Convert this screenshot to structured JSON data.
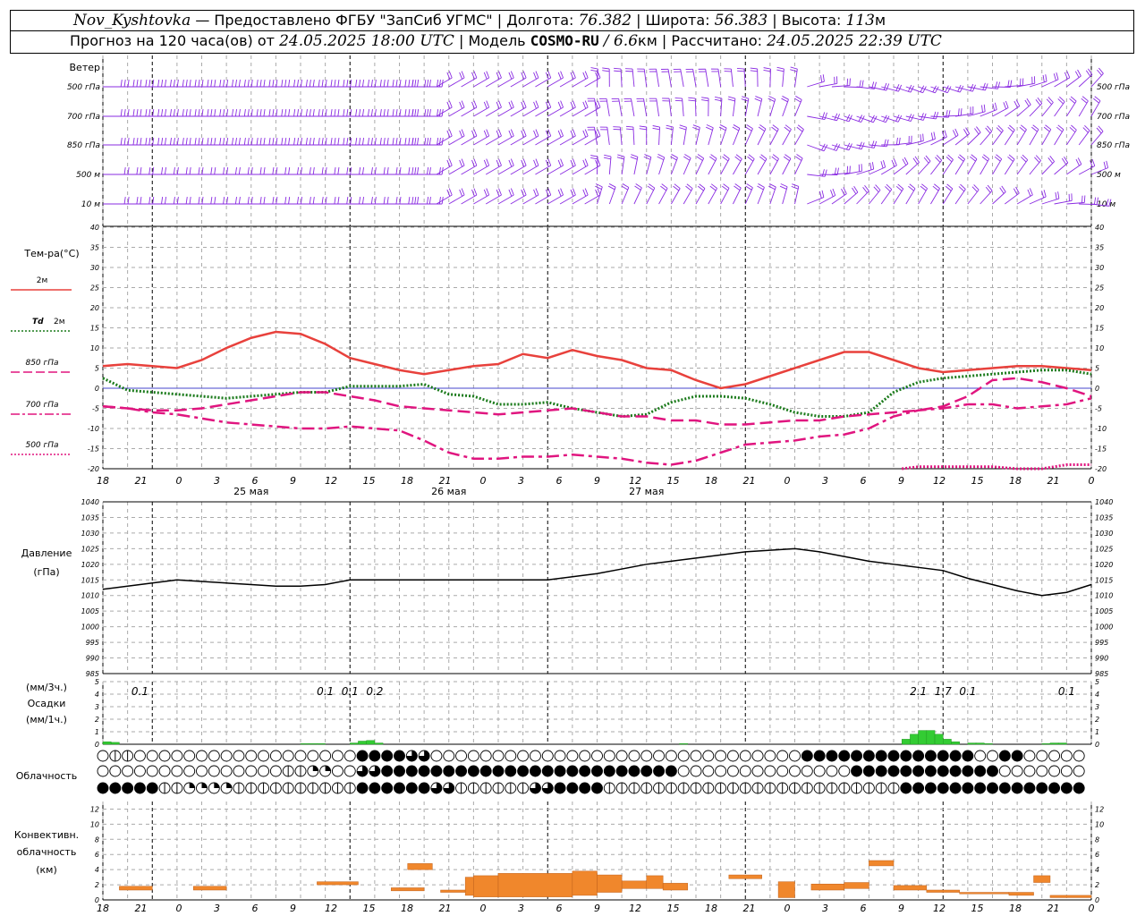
{
  "header": {
    "station": "Nov_Kyshtovka",
    "provider": "— Предоставлено ФГБУ \"ЗапСиб УГМС\" |",
    "lon_label": "Долгота:",
    "lon_value": "76.382",
    "lat_label": "| Широта:",
    "lat_value": "56.383",
    "alt_label": "| Высота:",
    "alt_value": "113",
    "alt_unit": "м",
    "forecast_label": "Прогноз на 120 часа(ов) от",
    "forecast_time": "24.05.2025 18:00 UTC",
    "model_label": "| Модель",
    "model_name": "COSMO-RU",
    "model_res": "/ 6.6",
    "model_res_unit": "км |",
    "calc_label": "Рассчитано:",
    "calc_time": "24.05.2025 22:39 UTC"
  },
  "time_axis": {
    "hour_labels": [
      "18",
      "21",
      "0",
      "3",
      "6",
      "9",
      "12",
      "15",
      "18",
      "21",
      "0",
      "3",
      "6",
      "9",
      "12",
      "15",
      "18",
      "21",
      "0",
      "3",
      "6",
      "9",
      "12",
      "15",
      "18",
      "21",
      "0"
    ],
    "day_labels": [
      "25 мая",
      "26 мая",
      "27 мая"
    ]
  },
  "wind_panel": {
    "title": "Ветер",
    "levels": [
      "500 гПа",
      "700 гПа",
      "850 гПа",
      "500 м",
      "10 м"
    ],
    "color": "#8a2be2"
  },
  "colors": {
    "t2m": "#e8413c",
    "td2m": "#1a7a1a",
    "t850": "#e0157f",
    "t700": "#e0157f",
    "t500": "#e0157f",
    "pressure": "#000000",
    "precip": "#33cc33",
    "convective": "#f0872c",
    "zero_line": "#4444cc"
  },
  "temp_panel": {
    "title": "Тем-ра(°C)",
    "legend": [
      {
        "label": "2м",
        "key": "t2m"
      },
      {
        "label": "Td",
        "label2": "2м",
        "key": "td2m"
      },
      {
        "label": "850 гПа",
        "key": "t850"
      },
      {
        "label": "700 гПа",
        "key": "t700"
      },
      {
        "label": "500 гПа",
        "key": "t500"
      }
    ],
    "y_ticks": [
      "40",
      "35",
      "30",
      "25",
      "20",
      "15",
      "10",
      "5",
      "0",
      "-5",
      "-10",
      "-15",
      "-20"
    ]
  },
  "pressure_panel": {
    "title": "Давление",
    "unit": "(гПа)",
    "y_ticks": [
      "1040",
      "1035",
      "1030",
      "1025",
      "1020",
      "1015",
      "1010",
      "1005",
      "1000",
      "995",
      "990",
      "985"
    ]
  },
  "precip_panel": {
    "unit1": "(мм/3ч.)",
    "title": "Осадки",
    "unit2": "(мм/1ч.)",
    "y_ticks": [
      "5",
      "4",
      "3",
      "2",
      "1",
      "0"
    ],
    "labels": [
      {
        "text": "0.1",
        "t": 4.5
      },
      {
        "text": "0.1",
        "t": 27
      },
      {
        "text": "0.1",
        "t": 30
      },
      {
        "text": "0.2",
        "t": 33
      },
      {
        "text": "2.1",
        "t": 99
      },
      {
        "text": "1.7",
        "t": 102
      },
      {
        "text": "0.1",
        "t": 105
      },
      {
        "text": "0.1",
        "t": 117
      }
    ]
  },
  "cloud_panel": {
    "title": "Облачность"
  },
  "conv_panel": {
    "title1": "Конвективн.",
    "title2": "облачность",
    "unit": "(км)",
    "y_ticks": [
      "12",
      "10",
      "8",
      "6",
      "4",
      "2",
      "0"
    ]
  },
  "chart_data": [
    {
      "type": "line",
      "title": "Тем-ра(°C)",
      "x_unit": "hours since 24.05.2025 18:00 UTC",
      "ylim": [
        -20,
        40
      ],
      "grid": true,
      "series": [
        {
          "name": "2м",
          "key": "t2m",
          "style": "solid",
          "x": [
            0,
            3,
            6,
            9,
            12,
            15,
            18,
            21,
            24,
            27,
            30,
            33,
            36,
            39,
            42,
            45,
            48,
            51,
            54,
            57,
            60,
            63,
            66,
            69,
            72,
            75,
            78,
            81,
            84,
            87,
            90,
            93,
            96,
            99,
            102,
            105,
            108,
            111,
            114,
            117,
            120
          ],
          "y": [
            5.5,
            6,
            5.5,
            5,
            7,
            10,
            12.5,
            14,
            13.5,
            11,
            7.5,
            6,
            4.5,
            3.5,
            4.5,
            5.5,
            6,
            8.5,
            7.5,
            9.5,
            8,
            7,
            5,
            4.5,
            2,
            0,
            1,
            3,
            5,
            7,
            9,
            9,
            7,
            5,
            4,
            4.5,
            5,
            5.5,
            5.5,
            5,
            4.5
          ]
        },
        {
          "name": "Td 2м",
          "key": "td2m",
          "style": "dotted",
          "x": [
            0,
            3,
            6,
            9,
            12,
            15,
            18,
            21,
            24,
            27,
            30,
            33,
            36,
            39,
            42,
            45,
            48,
            51,
            54,
            57,
            60,
            63,
            66,
            69,
            72,
            75,
            78,
            81,
            84,
            87,
            90,
            93,
            96,
            99,
            102,
            105,
            108,
            111,
            114,
            117,
            120
          ],
          "y": [
            2.5,
            -0.5,
            -1,
            -1.5,
            -2,
            -2.5,
            -2,
            -1.5,
            -1,
            -1,
            0.5,
            0.5,
            0.5,
            1,
            -1.5,
            -2,
            -4,
            -4,
            -3.5,
            -5,
            -6,
            -7,
            -6.5,
            -3.5,
            -2,
            -2,
            -2.5,
            -4,
            -6,
            -7,
            -7,
            -6,
            -1,
            1.5,
            2.5,
            3,
            3.5,
            4,
            4.5,
            4.5,
            3.5
          ]
        },
        {
          "name": "850 гПа",
          "key": "t850",
          "style": "dashed",
          "x": [
            0,
            3,
            6,
            9,
            12,
            15,
            18,
            21,
            24,
            27,
            30,
            33,
            36,
            39,
            42,
            45,
            48,
            51,
            54,
            57,
            60,
            63,
            66,
            69,
            72,
            75,
            78,
            81,
            84,
            87,
            90,
            93,
            96,
            99,
            102,
            105,
            108,
            111,
            114,
            117,
            120
          ],
          "y": [
            -4.5,
            -5,
            -5.5,
            -5.5,
            -5,
            -4,
            -3,
            -2,
            -1,
            -1,
            -2,
            -3,
            -4.5,
            -5,
            -5.5,
            -6,
            -6.5,
            -6,
            -5.5,
            -5,
            -6,
            -7,
            -7,
            -8,
            -8,
            -9,
            -9,
            -8.5,
            -8,
            -8,
            -7,
            -6.5,
            -6,
            -5.5,
            -4.5,
            -2,
            2,
            2.5,
            1.5,
            0,
            -2
          ]
        },
        {
          "name": "700 гПа",
          "key": "t700",
          "style": "dashdot",
          "x": [
            0,
            3,
            6,
            9,
            12,
            15,
            18,
            21,
            24,
            27,
            30,
            33,
            36,
            39,
            42,
            45,
            48,
            51,
            54,
            57,
            60,
            63,
            66,
            69,
            72,
            75,
            78,
            81,
            84,
            87,
            90,
            93,
            96,
            99,
            102,
            105,
            108,
            111,
            114,
            117,
            120
          ],
          "y": [
            -4.5,
            -5,
            -6,
            -6.5,
            -7.5,
            -8.5,
            -9,
            -9.5,
            -10,
            -10,
            -9.5,
            -10,
            -10.5,
            -13,
            -16,
            -17.5,
            -17.5,
            -17,
            -17,
            -16.5,
            -17,
            -17.5,
            -18.5,
            -19,
            -18,
            -16,
            -14,
            -13.5,
            -13,
            -12,
            -11.5,
            -10,
            -7,
            -5.5,
            -5,
            -4,
            -4,
            -5,
            -4.5,
            -4,
            -2.5
          ]
        },
        {
          "name": "500 гПа",
          "key": "t500",
          "style": "dotted",
          "x": [
            97,
            99,
            102,
            105,
            108,
            111,
            114,
            117,
            120
          ],
          "y": [
            -20,
            -19.5,
            -19.5,
            -19.5,
            -19.5,
            -20,
            -20,
            -19,
            -19
          ]
        }
      ]
    },
    {
      "type": "line",
      "title": "Давление",
      "ylabel": "(гПа)",
      "x_unit": "hours since 24.05.2025 18:00 UTC",
      "ylim": [
        985,
        1040
      ],
      "grid": true,
      "series": [
        {
          "key": "pressure",
          "x": [
            0,
            3,
            6,
            9,
            12,
            15,
            18,
            21,
            24,
            27,
            30,
            33,
            36,
            39,
            42,
            45,
            48,
            51,
            54,
            57,
            60,
            63,
            66,
            69,
            72,
            75,
            78,
            81,
            84,
            87,
            90,
            93,
            96,
            99,
            102,
            105,
            108,
            111,
            114,
            117,
            120
          ],
          "y": [
            1012,
            1013,
            1014,
            1015,
            1014.5,
            1014,
            1013.5,
            1013,
            1013,
            1013.5,
            1015,
            1015,
            1015,
            1015,
            1015,
            1015,
            1015,
            1015,
            1015,
            1016,
            1017,
            1018.5,
            1020,
            1021,
            1022,
            1023,
            1024,
            1024.5,
            1025,
            1024,
            1022.5,
            1021,
            1020,
            1019,
            1018,
            1015.5,
            1013.5,
            1011.5,
            1010,
            1011,
            1013.5
          ]
        }
      ]
    },
    {
      "type": "bar",
      "title": "Осадки",
      "ylabel": "(мм/1ч.)",
      "x_unit": "hours since 24.05.2025 18:00 UTC",
      "ylim": [
        0,
        5
      ],
      "x": [
        1,
        2,
        25,
        26,
        27,
        31,
        32,
        33,
        34,
        71,
        98,
        99,
        100,
        101,
        102,
        103,
        104,
        106,
        107,
        108,
        115,
        116,
        117
      ],
      "values": [
        0.2,
        0.15,
        0.05,
        0.05,
        0.05,
        0.1,
        0.25,
        0.3,
        0.1,
        0.05,
        0.4,
        0.8,
        1.1,
        1.1,
        0.8,
        0.4,
        0.2,
        0.1,
        0.1,
        0.05,
        0.05,
        0.1,
        0.1
      ]
    },
    {
      "type": "table",
      "title": "Облачность",
      "x_unit": "hours since 24.05.2025 18:00 UTC",
      "value_unit": "cloud fraction per layer (0-1)",
      "times": [
        0,
        3,
        6,
        9,
        12,
        15,
        18,
        21,
        24,
        27,
        30,
        33,
        36,
        39,
        42,
        45,
        48,
        51,
        54,
        57,
        60,
        63,
        66,
        69,
        72,
        75,
        78,
        81,
        84,
        87,
        90,
        93,
        96,
        99,
        102,
        105,
        108,
        111,
        114,
        117,
        120
      ],
      "rows": [
        [
          0,
          0.5,
          0,
          0,
          0,
          0,
          0,
          0,
          0,
          0,
          0,
          1,
          1,
          0.75,
          0,
          0,
          0,
          0,
          0,
          0,
          0,
          0,
          0,
          0,
          0,
          0,
          0,
          0,
          0,
          1,
          1,
          1,
          1,
          1,
          1,
          1,
          0,
          1,
          0,
          0,
          0
        ],
        [
          0,
          0,
          0,
          0,
          0,
          0,
          0,
          0,
          0.5,
          0.25,
          0,
          0.75,
          1,
          1,
          1,
          1,
          1,
          1,
          1,
          1,
          1,
          1,
          1,
          1,
          0,
          0,
          0,
          0,
          0,
          0,
          0,
          1,
          1,
          1,
          1,
          1,
          1,
          0,
          0,
          0,
          0
        ],
        [
          1,
          1,
          1,
          0.5,
          0.25,
          0.25,
          0.5,
          0.5,
          0.5,
          0.5,
          0.5,
          1,
          1,
          1,
          0.75,
          0.5,
          0.5,
          0.5,
          0.75,
          1,
          1,
          0.5,
          0.5,
          0.5,
          0.5,
          0.5,
          0.5,
          0.5,
          0.5,
          0.5,
          0.5,
          0.5,
          0.5,
          1,
          1,
          1,
          1,
          1,
          1,
          1,
          1
        ]
      ]
    },
    {
      "type": "bar",
      "title": "Конвективн. облачность",
      "ylabel": "(км)",
      "x_unit": "hours since 24.05.2025 18:00 UTC",
      "ylim": [
        0,
        13
      ],
      "segments": [
        {
          "t0": 2,
          "t1": 6,
          "bottom": 1.3,
          "top": 1.8
        },
        {
          "t0": 11,
          "t1": 15,
          "bottom": 1.3,
          "top": 1.8
        },
        {
          "t0": 26,
          "t1": 31,
          "bottom": 2,
          "top": 2.4
        },
        {
          "t0": 35,
          "t1": 39,
          "bottom": 1.2,
          "top": 1.6
        },
        {
          "t0": 37,
          "t1": 40,
          "bottom": 4,
          "top": 4.8
        },
        {
          "t0": 41,
          "t1": 44,
          "bottom": 1,
          "top": 1.3
        },
        {
          "t0": 44,
          "t1": 45,
          "bottom": 0.6,
          "top": 3
        },
        {
          "t0": 45,
          "t1": 48,
          "bottom": 0.4,
          "top": 3.2
        },
        {
          "t0": 48,
          "t1": 57,
          "bottom": 0.4,
          "top": 3.5
        },
        {
          "t0": 57,
          "t1": 60,
          "bottom": 0.6,
          "top": 3.8
        },
        {
          "t0": 60,
          "t1": 63,
          "bottom": 1,
          "top": 3.3
        },
        {
          "t0": 63,
          "t1": 66,
          "bottom": 1.5,
          "top": 2.5
        },
        {
          "t0": 66,
          "t1": 68,
          "bottom": 1.5,
          "top": 3.2
        },
        {
          "t0": 68,
          "t1": 71,
          "bottom": 1.3,
          "top": 2.2
        },
        {
          "t0": 76,
          "t1": 80,
          "bottom": 2.8,
          "top": 3.3
        },
        {
          "t0": 82,
          "t1": 84,
          "bottom": 0.3,
          "top": 2.4
        },
        {
          "t0": 86,
          "t1": 90,
          "bottom": 1.3,
          "top": 2.1
        },
        {
          "t0": 90,
          "t1": 93,
          "bottom": 1.5,
          "top": 2.3
        },
        {
          "t0": 93,
          "t1": 96,
          "bottom": 4.5,
          "top": 5.2
        },
        {
          "t0": 96,
          "t1": 100,
          "bottom": 1.3,
          "top": 1.9
        },
        {
          "t0": 100,
          "t1": 104,
          "bottom": 1,
          "top": 1.3
        },
        {
          "t0": 104,
          "t1": 110,
          "bottom": 0.8,
          "top": 1
        },
        {
          "t0": 110,
          "t1": 113,
          "bottom": 0.6,
          "top": 1
        },
        {
          "t0": 113,
          "t1": 115,
          "bottom": 2.3,
          "top": 3.2
        },
        {
          "t0": 115,
          "t1": 120,
          "bottom": 0.3,
          "top": 0.6
        }
      ]
    }
  ]
}
